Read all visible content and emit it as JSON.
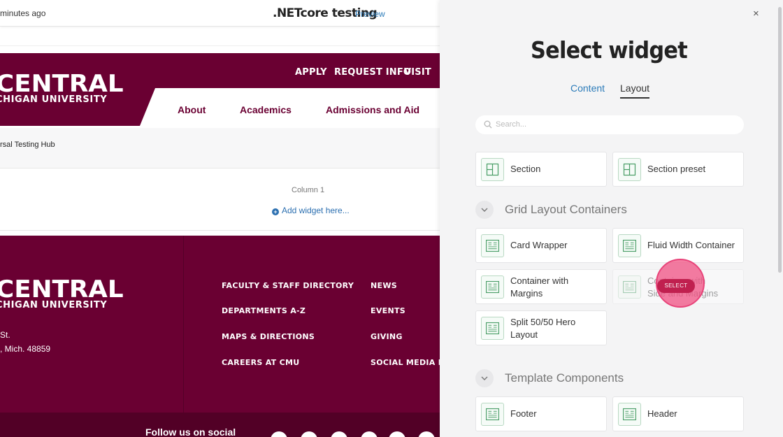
{
  "topbar": {
    "saved_text": "minutes ago",
    "page_name": ".NETcore testing",
    "preview_label": "Preview"
  },
  "header": {
    "logo_line1": "CENTRAL",
    "logo_line2": "CHIGAN UNIVERSITY",
    "utility_links": [
      "APPLY",
      "REQUEST INFO",
      "VISIT"
    ],
    "nav_items": [
      "About",
      "Academics",
      "Admissions and Aid"
    ]
  },
  "breadcrumb": "rsal Testing Hub",
  "column": {
    "title": "Column 1",
    "add_widget": "Add widget here..."
  },
  "footer": {
    "logo_line1": "CENTRAL",
    "logo_line2": "CHIGAN UNIVERSITY",
    "address_line1": "St.",
    "address_line2": ", Mich. 48859",
    "links_col1": [
      "FACULTY & STAFF DIRECTORY",
      "DEPARTMENTS A-Z",
      "MAPS & DIRECTIONS",
      "CAREERS AT CMU"
    ],
    "links_col2": [
      "NEWS",
      "EVENTS",
      "GIVING",
      "SOCIAL MEDIA DIR"
    ],
    "follow_text": "Follow us on social"
  },
  "panel": {
    "close_icon": "×",
    "title": "Select widget",
    "tabs": [
      {
        "label": "Content",
        "active": false
      },
      {
        "label": "Layout",
        "active": true
      }
    ],
    "search_placeholder": "Search...",
    "top_widgets": [
      "Section",
      "Section preset"
    ],
    "groups": [
      {
        "label": "Grid Layout Containers",
        "widgets": [
          "Card Wrapper",
          "Fluid Width Container",
          "Container with\nMargins",
          "Container with\nSide and Margins",
          "Split 50/50 Hero\nLayout"
        ]
      },
      {
        "label": "Template Components",
        "widgets": [
          "Footer",
          "Header"
        ]
      }
    ],
    "select_pill": "SELECT"
  },
  "colors": {
    "brand": "#6a0032",
    "accent_link": "#2b7bb9",
    "hint": "#e8447a",
    "icon_green": "#4a9e67"
  }
}
